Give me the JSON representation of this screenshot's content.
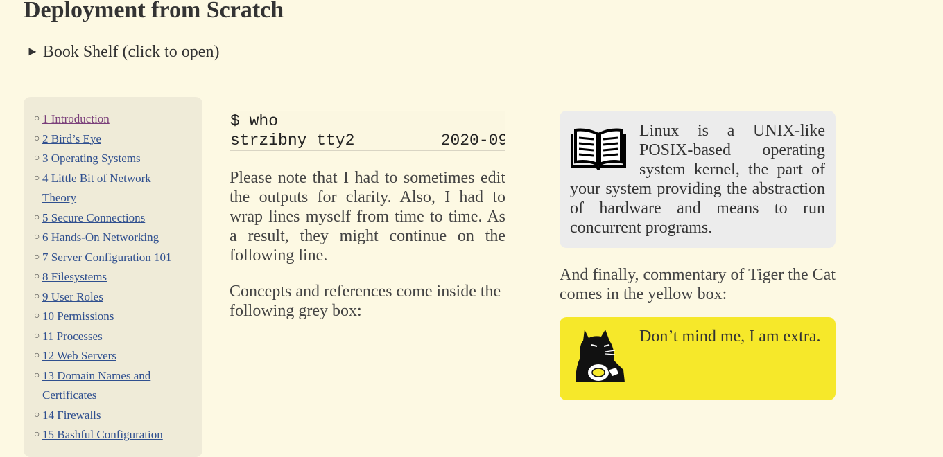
{
  "page": {
    "title": "Deployment from Scratch",
    "bookshelf_arrow": "►",
    "bookshelf_label": "Book Shelf (click to open)"
  },
  "toc": {
    "bullet": "○",
    "items": [
      {
        "label": "1 Introduction",
        "visited": true
      },
      {
        "label": "2 Bird’s Eye"
      },
      {
        "label": "3 Operating Systems"
      },
      {
        "label": "4 Little Bit of Network Theory"
      },
      {
        "label": "5 Secure Connections"
      },
      {
        "label": "6 Hands-On Networking"
      },
      {
        "label": "7 Server Configuration 101"
      },
      {
        "label": "8 Filesystems"
      },
      {
        "label": "9 User Roles"
      },
      {
        "label": "10 Permissions"
      },
      {
        "label": "11 Processes"
      },
      {
        "label": "12 Web Servers"
      },
      {
        "label": "13 Domain Names and Certificates"
      },
      {
        "label": "14 Firewalls"
      },
      {
        "label": "15 Bashful Configuration"
      }
    ]
  },
  "code": {
    "line1": "$ who",
    "line2": "strzibny tty2         2020-09"
  },
  "main": {
    "p1": "Please note that I had to sometimes edit the outputs for clarity. Also, I had to wrap lines myself from time to time. As a result, they might continue on the following line.",
    "p2": "Concepts and references come inside the following grey box:",
    "p3": "And finally, commentary of Tiger the Cat comes in the yellow box:"
  },
  "greybox": {
    "text": "Linux is a UNIX-like POSIX-based operating system kernel, the part of your system providing the abstraction of hardware and means to run concurrent programs.",
    "icon": "book-icon"
  },
  "yellowbox": {
    "text": "Don’t mind me, I am extra.",
    "icon": "tiger-cat-icon",
    "color": "#f6e82a"
  }
}
